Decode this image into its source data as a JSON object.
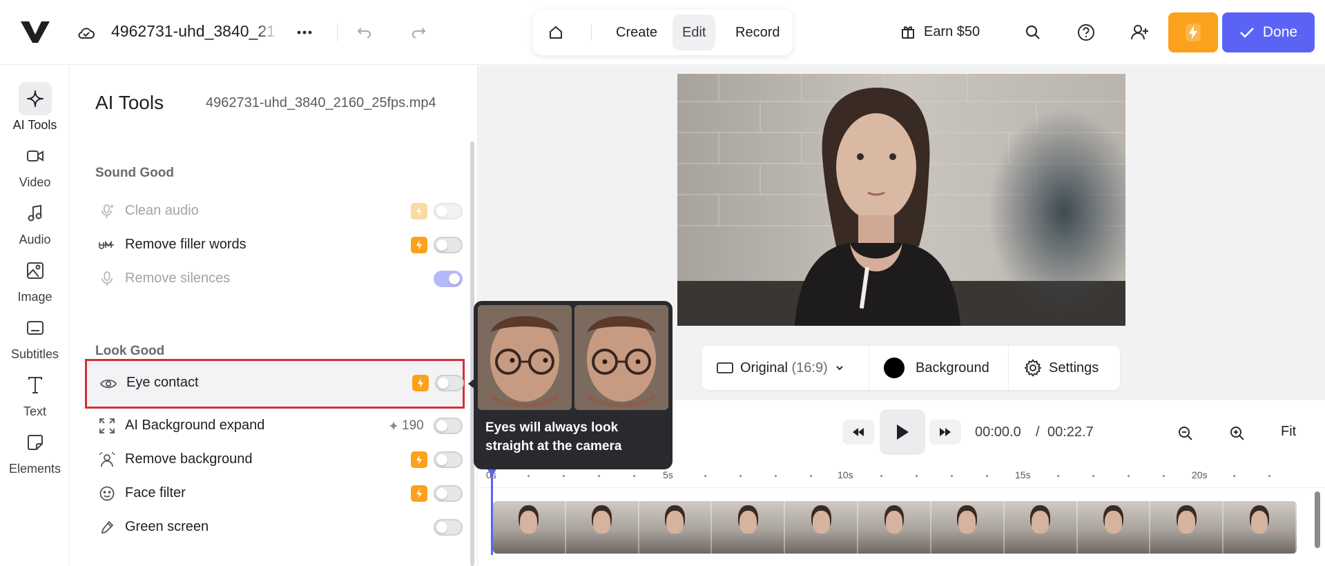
{
  "app": {
    "filename": "4962731-uhd_3840_2160_25fps.mp4",
    "brand_color": "#1f1f23"
  },
  "topbar": {
    "modes": [
      {
        "label": "Create",
        "active": false
      },
      {
        "label": "Edit",
        "active": true
      },
      {
        "label": "Record",
        "active": false
      }
    ],
    "earn_label": "Earn $50",
    "done_label": "Done",
    "accent": "#5b63f5",
    "upgrade_color": "#fba11b"
  },
  "rail": {
    "items": [
      {
        "label": "AI Tools",
        "icon": "sparkle-icon",
        "active": true
      },
      {
        "label": "Video",
        "icon": "video-icon"
      },
      {
        "label": "Audio",
        "icon": "music-note-icon"
      },
      {
        "label": "Image",
        "icon": "image-icon"
      },
      {
        "label": "Subtitles",
        "icon": "subtitles-icon"
      },
      {
        "label": "Text",
        "icon": "text-icon"
      },
      {
        "label": "Elements",
        "icon": "elements-icon"
      }
    ]
  },
  "panel": {
    "title": "AI Tools",
    "file": "4962731-uhd_3840_2160_25fps.mp4",
    "sections": [
      {
        "label": "Sound Good",
        "tools": [
          {
            "label": "Clean audio",
            "icon": "microphone-sparkle-icon",
            "premium": true,
            "disabled": true,
            "on": false
          },
          {
            "label": "Remove filler words",
            "icon": "um-strikethrough-icon",
            "premium": true,
            "disabled": false,
            "on": false
          },
          {
            "label": "Remove silences",
            "icon": "microphone-icon",
            "premium": false,
            "disabled": true,
            "on": true
          }
        ]
      },
      {
        "label": "Look Good",
        "tools": [
          {
            "label": "Eye contact",
            "icon": "eye-icon",
            "premium": true,
            "highlighted": true,
            "on": false
          },
          {
            "label": "AI Background expand",
            "icon": "expand-icon",
            "credits": "190",
            "on": false
          },
          {
            "label": "Remove background",
            "icon": "person-cutout-icon",
            "premium": true,
            "on": false
          },
          {
            "label": "Face filter",
            "icon": "face-sparkle-icon",
            "premium": true,
            "on": false
          },
          {
            "label": "Green screen",
            "icon": "eyedropper-icon",
            "premium": false,
            "on": false
          }
        ]
      }
    ]
  },
  "tooltip": {
    "text": "Eyes will always look straight at the camera"
  },
  "canvas_toolbar": {
    "ratio_label": "Original",
    "ratio_value": "(16:9)",
    "background_label": "Background",
    "settings_label": "Settings"
  },
  "playback": {
    "current_time": "00:00.0",
    "separator": "/",
    "total_time": "00:22.7",
    "fit_label": "Fit"
  },
  "timeline": {
    "ticks": [
      "0s",
      "5s",
      "10s",
      "15s",
      "20s"
    ],
    "frame_count": 11
  }
}
